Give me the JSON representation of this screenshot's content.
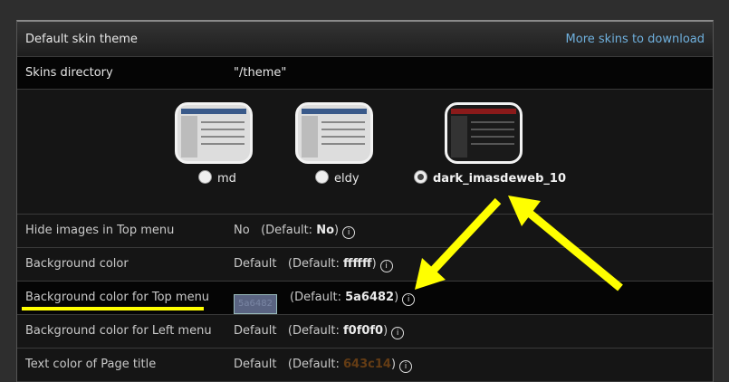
{
  "header": {
    "title": "Default skin theme",
    "link": "More skins to download"
  },
  "skins_directory": {
    "label": "Skins directory",
    "value": "\"/theme\""
  },
  "skins": [
    {
      "name": "md",
      "selected": false
    },
    {
      "name": "eldy",
      "selected": false
    },
    {
      "name": "dark_imasdeweb_10",
      "selected": true
    }
  ],
  "rows": [
    {
      "label": "Hide images in Top menu",
      "value": "No",
      "default_prefix": "(Default: ",
      "default_value": "No",
      "default_suffix": ")"
    },
    {
      "label": "Background color",
      "value": "Default",
      "default_prefix": "(Default: ",
      "default_value": "ffffff",
      "default_suffix": ")"
    },
    {
      "label": "Background color for Top menu",
      "value": "5a6482",
      "default_prefix": "(Default: ",
      "default_value": "5a6482",
      "default_suffix": ")"
    },
    {
      "label": "Background color for Left menu",
      "value": "Default",
      "default_prefix": "(Default: ",
      "default_value": "f0f0f0",
      "default_suffix": ")"
    },
    {
      "label": "Text color of Page title",
      "value": "Default",
      "default_prefix": "(Default: ",
      "default_value": "643c14",
      "default_suffix": ")"
    }
  ],
  "colors": {
    "annotation": "#ffff00",
    "link": "#6fb0dd",
    "top_menu_swatch": "#5a6482",
    "title_color_default": "#643c14"
  },
  "icons": {
    "info": "info-circle-icon"
  }
}
